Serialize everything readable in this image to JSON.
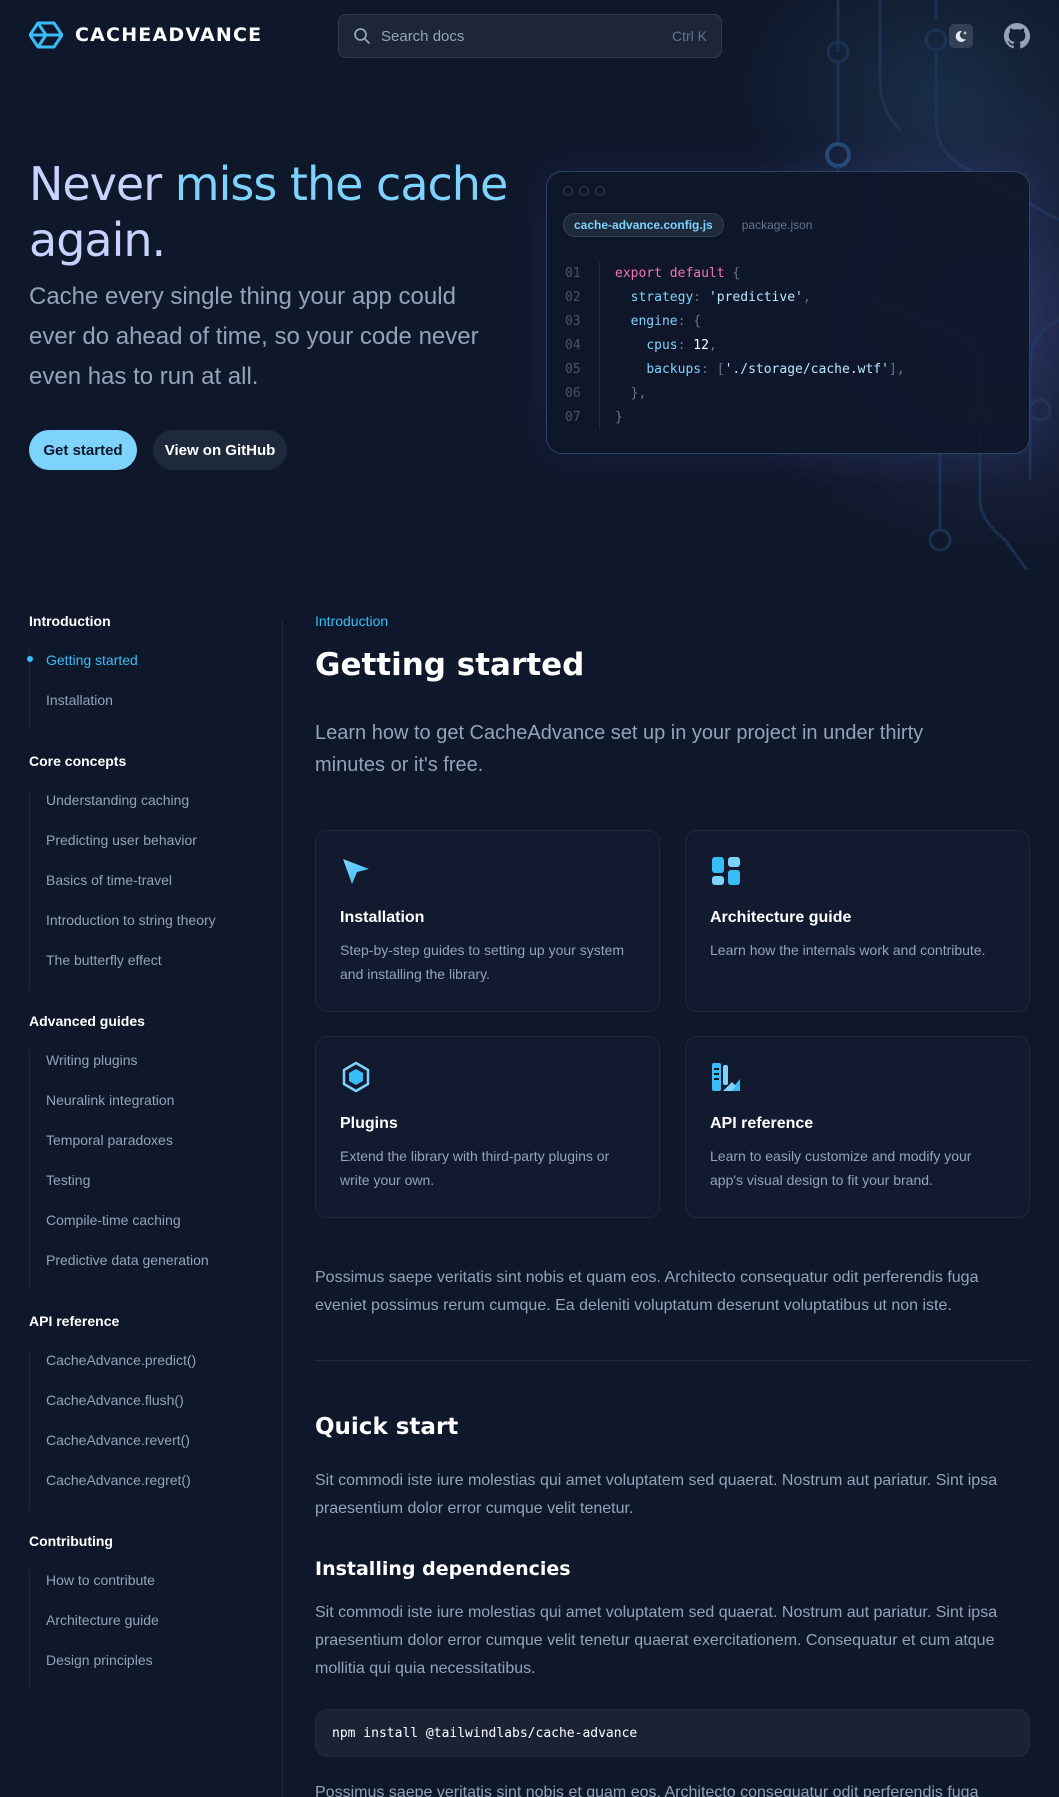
{
  "header": {
    "logo_text": "CACHEADVANCE",
    "search_placeholder": "Search docs",
    "search_shortcut": "Ctrl K"
  },
  "hero": {
    "title_line1_pre": "Never ",
    "title_line1_highlight": "miss the cache",
    "title_line2": "again.",
    "subtitle": "Cache every single thing your app could ever do ahead of time, so your code never even has to run at all.",
    "primary_button": "Get started",
    "secondary_button": "View on GitHub"
  },
  "code_card": {
    "tabs": [
      "cache-advance.config.js",
      "package.json"
    ],
    "line_numbers": [
      "01",
      "02",
      "03",
      "04",
      "05",
      "06",
      "07"
    ],
    "lines": [
      "export default {",
      "  strategy: 'predictive',",
      "  engine: {",
      "    cpus: 12,",
      "    backups: ['./storage/cache.wtf'],",
      "  },",
      "}"
    ]
  },
  "sidebar": {
    "sections": [
      {
        "heading": "Introduction",
        "items": [
          "Getting started",
          "Installation"
        ]
      },
      {
        "heading": "Core concepts",
        "items": [
          "Understanding caching",
          "Predicting user behavior",
          "Basics of time-travel",
          "Introduction to string theory",
          "The butterfly effect"
        ]
      },
      {
        "heading": "Advanced guides",
        "items": [
          "Writing plugins",
          "Neuralink integration",
          "Temporal paradoxes",
          "Testing",
          "Compile-time caching",
          "Predictive data generation"
        ]
      },
      {
        "heading": "API reference",
        "items": [
          "CacheAdvance.predict()",
          "CacheAdvance.flush()",
          "CacheAdvance.revert()",
          "CacheAdvance.regret()"
        ]
      },
      {
        "heading": "Contributing",
        "items": [
          "How to contribute",
          "Architecture guide",
          "Design principles"
        ]
      }
    ],
    "active_item": "Getting started"
  },
  "main": {
    "eyebrow": "Introduction",
    "title": "Getting started",
    "lead": "Learn how to get CacheAdvance set up in your project in under thirty minutes or it's free.",
    "cards": [
      {
        "icon": "cursor-arrow-icon",
        "title": "Installation",
        "desc": "Step-by-step guides to setting up your system and installing the library."
      },
      {
        "icon": "layout-blocks-icon",
        "title": "Architecture guide",
        "desc": "Learn how the internals work and contribute."
      },
      {
        "icon": "hexagon-plugin-icon",
        "title": "Plugins",
        "desc": "Extend the library with third-party plugins or write your own."
      },
      {
        "icon": "theming-ruler-icon",
        "title": "API reference",
        "desc": "Learn to easily customize and modify your app's visual design to fit your brand."
      }
    ],
    "paragraph1": "Possimus saepe veritatis sint nobis et quam eos. Architecto consequatur odit perferendis fuga eveniet possimus rerum cumque. Ea deleniti voluptatum deserunt voluptatibus ut non iste.",
    "quick_start_heading": "Quick start",
    "quick_start_text": "Sit commodi iste iure molestias qui amet voluptatem sed quaerat. Nostrum aut pariatur. Sint ipsa praesentium dolor error cumque velit tenetur.",
    "installing_heading": "Installing dependencies",
    "installing_text": "Sit commodi iste iure molestias qui amet voluptatem sed quaerat. Nostrum aut pariatur. Sint ipsa praesentium dolor error cumque velit tenetur quaerat exercitationem. Consequatur et cum atque mollitia qui quia necessitatibus.",
    "install_command": "npm install @tailwindlabs/cache-advance",
    "trailing_text": "Possimus saepe veritatis sint nobis et quam eos. Architecto consequatur odit perferendis fuga eveniet possimus rerum cumque."
  },
  "colors": {
    "background": "#0f172a",
    "accent": "#38bdf8",
    "accent_light": "#7dd3fc",
    "title": "#c7d2fe"
  }
}
